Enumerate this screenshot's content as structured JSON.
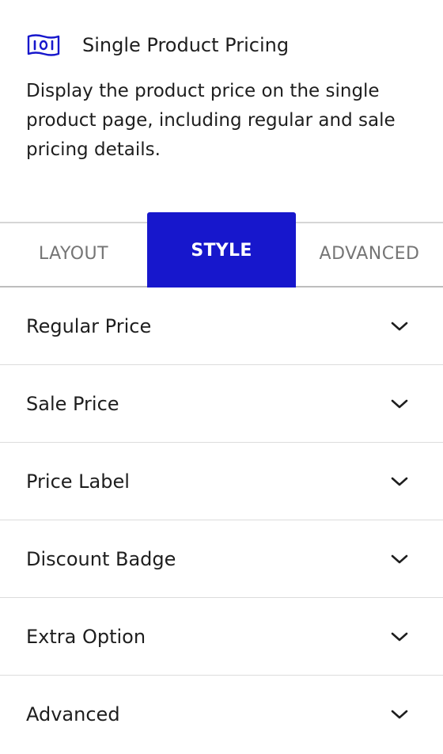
{
  "header": {
    "icon": "banknote-icon",
    "title": "Single Product Pricing",
    "description": "Display the product price on the single product page, including regular and sale pricing details."
  },
  "tabs": [
    {
      "label": "LAYOUT",
      "active": false
    },
    {
      "label": "STYLE",
      "active": true
    },
    {
      "label": "ADVANCED",
      "active": false
    }
  ],
  "sections": [
    {
      "label": "Regular Price",
      "icon": "chevron-down-icon"
    },
    {
      "label": "Sale Price",
      "icon": "chevron-down-icon"
    },
    {
      "label": "Price Label",
      "icon": "chevron-down-icon"
    },
    {
      "label": "Discount Badge",
      "icon": "chevron-down-icon"
    },
    {
      "label": "Extra Option",
      "icon": "chevron-down-icon"
    },
    {
      "label": "Advanced",
      "icon": "chevron-down-icon"
    }
  ],
  "colors": {
    "accent": "#1717cc",
    "text": "#1e1e1e",
    "muted": "#757575",
    "divider": "#dcdcdc"
  }
}
